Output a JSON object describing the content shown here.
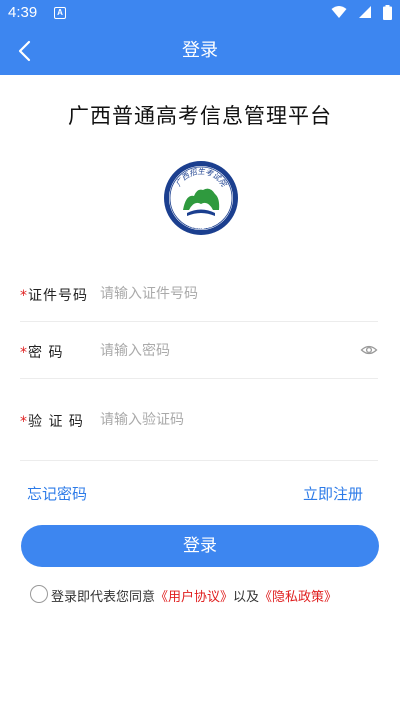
{
  "status_bar": {
    "time": "4:39",
    "notification_letter": "A"
  },
  "nav": {
    "title": "登录",
    "back_icon": "chevron-left-icon"
  },
  "app_title": "广西普通高考信息管理平台",
  "logo": {
    "arc_text": "广西招生考试院",
    "ring_text": "GUANGXI ZHAOSHENG KAOSHIYUAN"
  },
  "form": {
    "required_mark": "*",
    "id_number": {
      "label": "证件号码",
      "placeholder": "请输入证件号码",
      "value": ""
    },
    "password": {
      "label": "密 码",
      "placeholder": "请输入密码",
      "value": "",
      "toggle_icon": "eye-icon"
    },
    "captcha": {
      "label": "验 证 码",
      "placeholder": "请输入验证码",
      "value": ""
    }
  },
  "links": {
    "forgot": "忘记密码",
    "register": "立即注册"
  },
  "login_button": "登录",
  "agreement": {
    "prefix": "登录即代表您同意",
    "user_agreement": "《用户协议》",
    "middle": "以及",
    "privacy_policy": "《隐私政策》"
  },
  "colors": {
    "primary": "#3d86f0",
    "link": "#2d7be8",
    "required": "#e02020",
    "logo_navy": "#1b3f8f",
    "logo_green": "#2f9a3e"
  }
}
